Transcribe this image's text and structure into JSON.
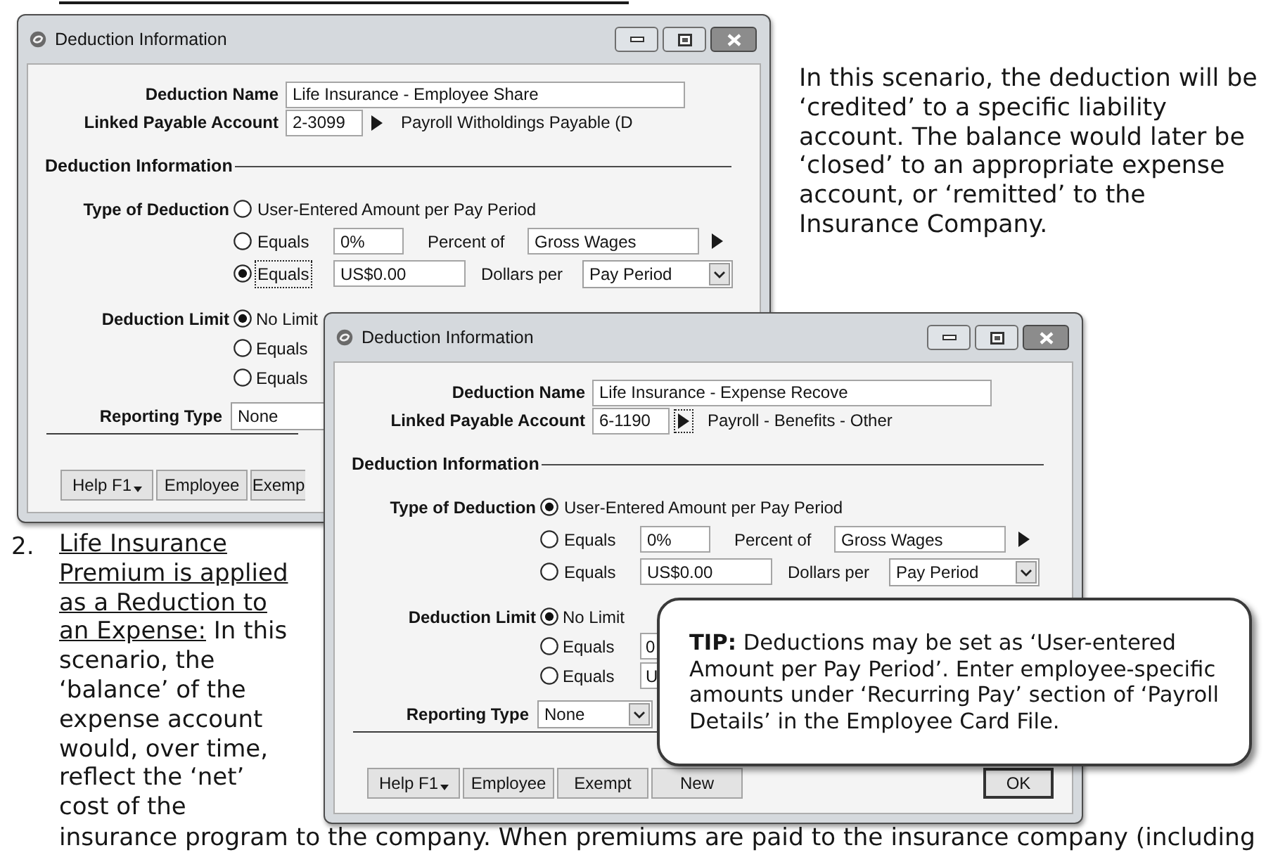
{
  "intro": "In this scenario, the deduction will be ‘credited’ to a specific liability account. The balance would later be ‘closed’ to an appropriate expense account, or ‘remitted’ to the Insurance Company.",
  "list_item": {
    "number": "2.",
    "heading": "Life Insurance Premium is applied as a Reduction to an Expense:",
    "text": "In this scenario, the ‘balance’ of the expense account would, over time, reflect the ‘net’ cost of the"
  },
  "continuation": "insurance program to the company. When premiums are paid to the insurance company (including",
  "windows": [
    {
      "title": "Deduction Information",
      "deduction_name": {
        "label": "Deduction Name",
        "value": "Life Insurance - Employee Share"
      },
      "linked_account": {
        "label": "Linked Payable Account",
        "value": "2-3099",
        "focused": false,
        "account_name": "Payroll Witholdings Payable (D"
      },
      "section": "Deduction Information",
      "type_of_deduction": {
        "label": "Type of Deduction",
        "options": [
          {
            "kind": "plain",
            "label": "User-Entered Amount per Pay Period",
            "selected": false,
            "focused": false
          },
          {
            "kind": "percent",
            "label": "Equals",
            "selected": false,
            "focused": false,
            "value": "0%",
            "unit": "Percent of",
            "basis": "Gross Wages"
          },
          {
            "kind": "dollars",
            "label": "Equals",
            "selected": true,
            "focused": true,
            "value": "US$0.00",
            "unit": "Dollars per",
            "basis": "Pay Period"
          }
        ]
      },
      "deduction_limit": {
        "label": "Deduction Limit",
        "options": [
          {
            "label": "No Limit",
            "selected": true
          },
          {
            "label": "Equals",
            "selected": false
          },
          {
            "label": "Equals",
            "selected": false
          }
        ]
      },
      "reporting_type": {
        "label": "Reporting Type",
        "value": "None",
        "dropdown": false
      },
      "buttons": [
        {
          "kind": "menu",
          "label": "Help F1"
        },
        {
          "kind": "plain",
          "label": "Employee"
        },
        {
          "kind": "plain",
          "label": "Exemp"
        }
      ]
    },
    {
      "title": "Deduction Information",
      "deduction_name": {
        "label": "Deduction Name",
        "value": "Life Insurance - Expense Recove"
      },
      "linked_account": {
        "label": "Linked Payable Account",
        "value": "6-1190",
        "focused": true,
        "account_name": "Payroll - Benefits - Other"
      },
      "section": "Deduction Information",
      "type_of_deduction": {
        "label": "Type of Deduction",
        "options": [
          {
            "kind": "plain",
            "label": "User-Entered Amount per Pay Period",
            "selected": true,
            "focused": false
          },
          {
            "kind": "percent",
            "label": "Equals",
            "selected": false,
            "focused": false,
            "value": "0%",
            "unit": "Percent of",
            "basis": "Gross Wages"
          },
          {
            "kind": "dollars",
            "label": "Equals",
            "selected": false,
            "focused": false,
            "value": "US$0.00",
            "unit": "Dollars per",
            "basis": "Pay Period"
          }
        ]
      },
      "deduction_limit": {
        "label": "Deduction Limit",
        "options": [
          {
            "label": "No Limit",
            "selected": true
          },
          {
            "label": "Equals",
            "selected": false,
            "value": "0"
          },
          {
            "label": "Equals",
            "selected": false,
            "value": "U"
          }
        ]
      },
      "reporting_type": {
        "label": "Reporting Type",
        "value": "None",
        "dropdown": true
      },
      "buttons": [
        {
          "kind": "menu",
          "label": "Help F1"
        },
        {
          "kind": "plain",
          "label": "Employee"
        },
        {
          "kind": "plain",
          "label": "Exempt"
        },
        {
          "kind": "plain",
          "label": "New"
        },
        {
          "kind": "default",
          "label": "OK"
        }
      ]
    }
  ],
  "tip": "**TIP:** Deductions may be set as ‘User-entered Amount per Pay Period’. Enter employee-specific amounts under ‘Recurring Pay’ section of ‘Payroll Details’ in the Employee Card File."
}
